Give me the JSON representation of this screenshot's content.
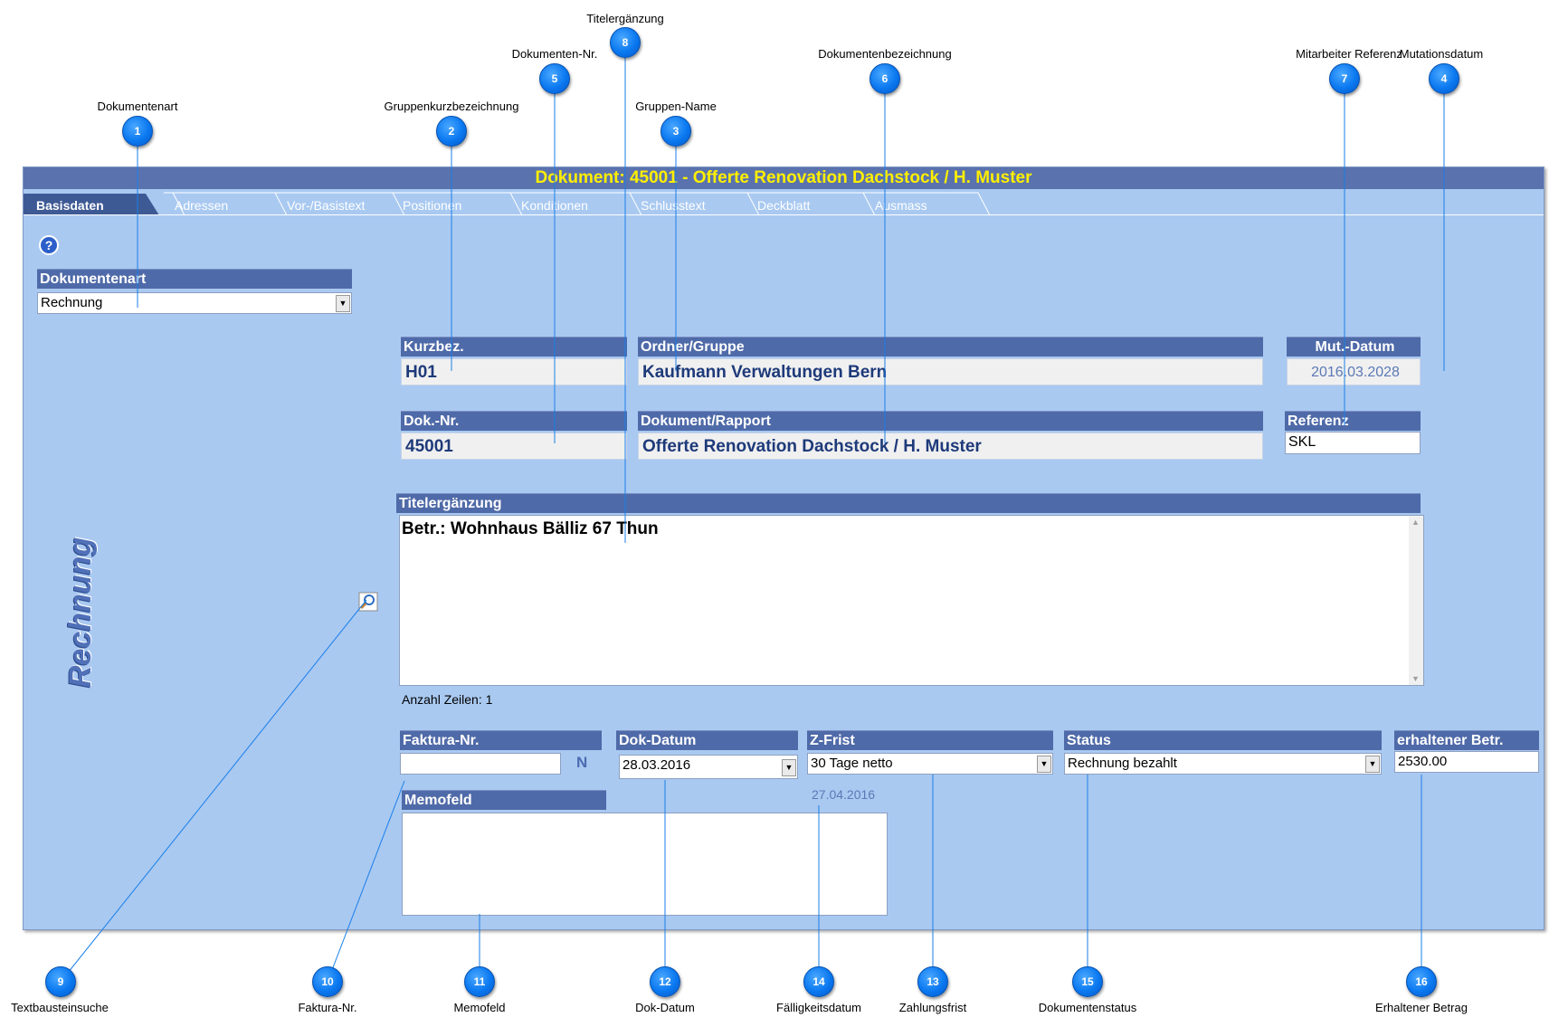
{
  "window": {
    "title": "Dokument: 45001 - Offerte Renovation Dachstock / H. Muster",
    "tabs": [
      "Basisdaten",
      "Adressen",
      "Vor-/Basistext",
      "Positionen",
      "Konditionen",
      "Schlusstext",
      "Deckblatt",
      "Ausmass"
    ],
    "active_tab": "Basisdaten",
    "side_label": "Rechnung"
  },
  "fields": {
    "dokumentenart": {
      "label": "Dokumentenart",
      "value": "Rechnung"
    },
    "kurzbez": {
      "label": "Kurzbez.",
      "value": "H01"
    },
    "ordner_gruppe": {
      "label": "Ordner/Gruppe",
      "value": "Kaufmann Verwaltungen Bern"
    },
    "mut_datum": {
      "label": "Mut.-Datum",
      "value": "2016.03.2028"
    },
    "dok_nr": {
      "label": "Dok.-Nr.",
      "value": "45001"
    },
    "dokument_rapport": {
      "label": "Dokument/Rapport",
      "value": "Offerte Renovation Dachstock / H. Muster"
    },
    "referenz": {
      "label": "Referenz",
      "value": "SKL"
    },
    "titelergaenzung": {
      "label": "Titelergänzung",
      "value": "Betr.: Wohnhaus Bälliz 67 Thun"
    },
    "anzahl_zeilen": "Anzahl Zeilen: 1",
    "faktura_nr": {
      "label": "Faktura-Nr.",
      "value": "",
      "flag": "N"
    },
    "dok_datum": {
      "label": "Dok-Datum",
      "value": "28.03.2016"
    },
    "z_frist": {
      "label": "Z-Frist",
      "value": "30 Tage netto",
      "due_date": "27.04.2016"
    },
    "status": {
      "label": "Status",
      "value": "Rechnung bezahlt"
    },
    "erhaltener_betr": {
      "label": "erhaltener Betr.",
      "value": "2530.00"
    },
    "memofeld": {
      "label": "Memofeld",
      "value": ""
    }
  },
  "callouts": [
    {
      "n": "1",
      "label": "Dokumentenart"
    },
    {
      "n": "2",
      "label": "Gruppenkurzbezeichnung"
    },
    {
      "n": "3",
      "label": "Gruppen-Name"
    },
    {
      "n": "4",
      "label": "Mutationsdatum"
    },
    {
      "n": "5",
      "label": "Dokumenten-Nr."
    },
    {
      "n": "6",
      "label": "Dokumentenbezeichnung"
    },
    {
      "n": "7",
      "label": "Mitarbeiter Referenz"
    },
    {
      "n": "8",
      "label": "Titelergänzung"
    },
    {
      "n": "9",
      "label": "Textbausteinsuche"
    },
    {
      "n": "10",
      "label": "Faktura-Nr."
    },
    {
      "n": "11",
      "label": "Memofeld"
    },
    {
      "n": "12",
      "label": "Dok-Datum"
    },
    {
      "n": "14",
      "label": "Fälligkeitsdatum"
    },
    {
      "n": "13",
      "label": "Zahlungsfrist"
    },
    {
      "n": "15",
      "label": "Dokumentenstatus"
    },
    {
      "n": "16",
      "label": "Erhaltener Betrag"
    }
  ],
  "colors": {
    "window_bg": "#a9c9f1",
    "header_bg": "#4f6aa8",
    "title_text": "#ffef00",
    "value_text": "#1e3a7a",
    "marker": "#0a78f0"
  }
}
